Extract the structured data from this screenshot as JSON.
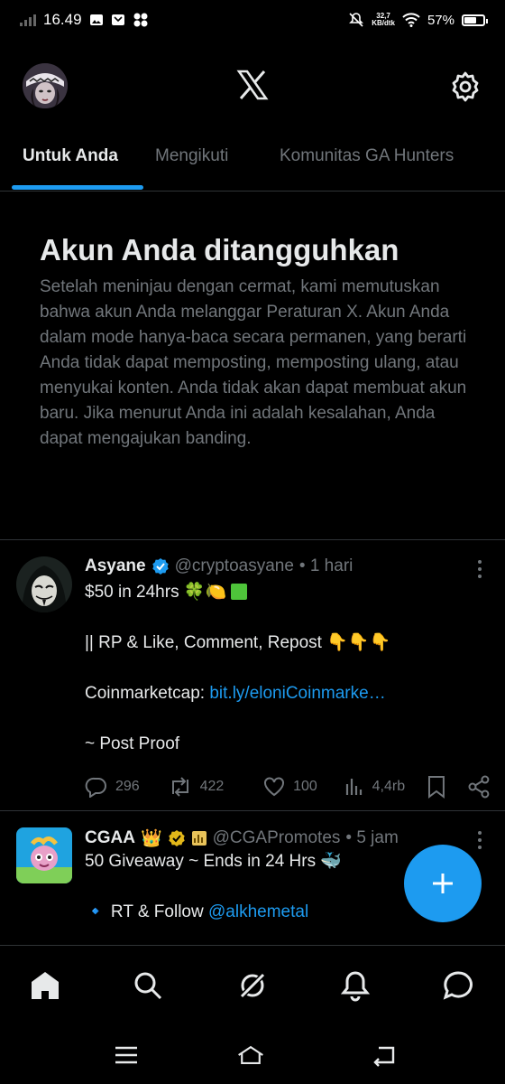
{
  "status_bar": {
    "time": "16.49",
    "net_speed_top": "32,7",
    "net_speed_bottom": "KB/dtk",
    "battery": "57%",
    "battery_level": 0.57
  },
  "header": {
    "logo_icon": "x-logo-icon",
    "settings_icon": "gear-icon"
  },
  "tabs": [
    {
      "label": "Untuk Anda",
      "active": true
    },
    {
      "label": "Mengikuti",
      "active": false
    },
    {
      "label": "Komunitas GA Hunters",
      "active": false
    }
  ],
  "notice": {
    "title": "Akun Anda ditangguhkan",
    "body": "Setelah meninjau dengan cermat, kami memutuskan bahwa akun Anda melanggar Peraturan X. Akun Anda dalam mode hanya-baca secara permanen, yang berarti Anda tidak dapat memposting, memposting ulang, atau menyukai konten. Anda tidak akan dapat membuat akun baru. Jika menurut Anda ini adalah kesalahan, Anda dapat mengajukan banding."
  },
  "posts": [
    {
      "name": "Asyane",
      "handle": "@cryptoasyane",
      "time": "• 1 hari",
      "line1": "$50 in 24hrs 🍀🍋",
      "line2": "|| RP & Like, Comment, Repost 👇👇👇",
      "line3_prefix": "Coinmarketcap: ",
      "line3_link": "bit.ly/eloniCoinmarke…",
      "line4": "~ Post Proof",
      "replies": "296",
      "reposts": "422",
      "likes": "100",
      "views": "4,4rb"
    },
    {
      "name": "CGAA",
      "badges": "👑",
      "handle": "@CGAPromotes",
      "time": "• 5 jam",
      "line1": "50 Giveaway ~ Ends in 24 Hrs 🐳",
      "line2_prefix": "🔹 RT & Follow ",
      "line2_link": "@alkhemetal"
    }
  ],
  "compose": {
    "icon": "plus-icon"
  },
  "bottom_nav": [
    "home-icon",
    "search-icon",
    "grok-icon",
    "notifications-icon",
    "messages-icon"
  ],
  "system_nav": [
    "menu-icon",
    "home-icon",
    "back-icon"
  ],
  "colors": {
    "accent": "#1d9bf0",
    "background": "#000000",
    "text_primary": "#e7e9ea",
    "text_secondary": "#71767b",
    "divider": "#2f3336"
  }
}
